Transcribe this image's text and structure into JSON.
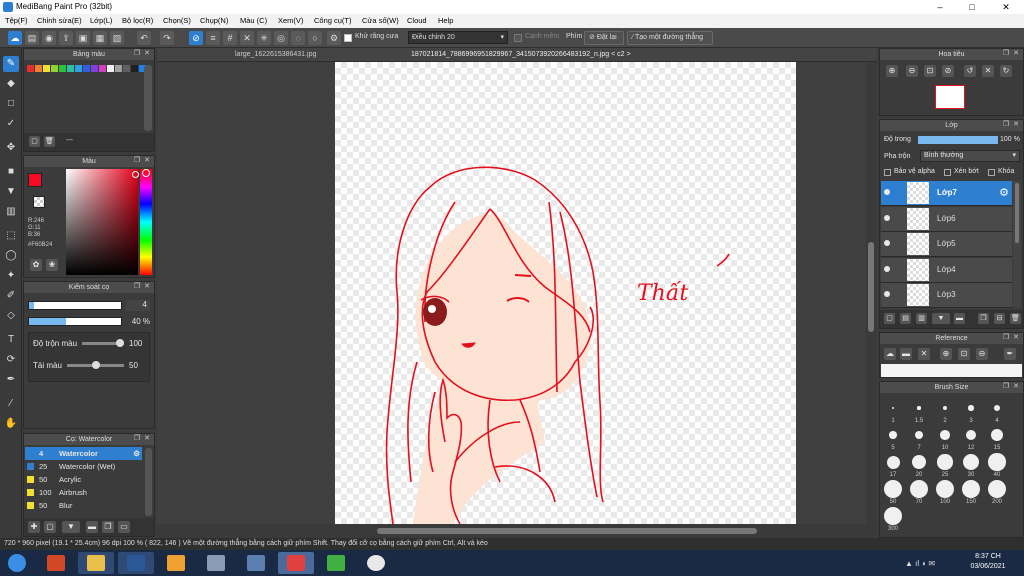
{
  "window": {
    "title": "MediBang Paint Pro (32bit)",
    "min": "–",
    "max": "□",
    "close": "✕"
  },
  "menu": [
    "Tệp(F)",
    "Chỉnh sửa(E)",
    "Lớp(L)",
    "Bộ lọc(R)",
    "Chọn(S)",
    "Chụp(N)",
    "Màu (C)",
    "Xem(V)",
    "Công cụ(T)",
    "Cửa sổ(W)",
    "Cloud",
    "Help"
  ],
  "toolbar": {
    "antialias_label": "Khử răng cưa",
    "correction_label": "Điều chỉnh",
    "correction_value": "20",
    "edge_label": "Cạnh mềm",
    "key_label": "Phím",
    "reset_label": "Đặt lại",
    "new_line_label": "Tạo một đường thẳng"
  },
  "colors": {
    "accent": "#2f7fd0",
    "stroke": "#e3101e",
    "skin": "#fde3d3"
  },
  "color_swatches_panel": {
    "title": "Bảng màu",
    "swatches": [
      "#e03030",
      "#f08030",
      "#f0e030",
      "#90d030",
      "#30c040",
      "#30c0a0",
      "#30a0e0",
      "#3060e0",
      "#8040e0",
      "#d040c0",
      "#f0f0f0",
      "#a0a0a0",
      "#606060",
      "#202020",
      "#2080f0"
    ],
    "footer": "---"
  },
  "color_panel": {
    "title": "Màu",
    "r": "R:246",
    "g": "G:11",
    "b": "B:36",
    "hex": "#F60B24",
    "primary": "#f60b24"
  },
  "brush_control": {
    "title": "Kiểm soát cọ",
    "size_value": "4",
    "opacity_value": "40 %",
    "mix_label": "Độ trộn màu",
    "mix_value": "100",
    "reload_label": "Tải màu",
    "reload_value": "50",
    "opacity_fraction": 0.4,
    "size_fraction": 0.05,
    "mix_fraction": 1.0,
    "reload_fraction": 0.5
  },
  "brush_list": {
    "title": "Cọ: Watercolor",
    "items": [
      {
        "size": "4",
        "name": "Watercolor",
        "color": "#2f7fd0"
      },
      {
        "size": "25",
        "name": "Watercolor (Wet)",
        "color": "#2f7fd0"
      },
      {
        "size": "50",
        "name": "Acrylic",
        "color": "#f0e030"
      },
      {
        "size": "100",
        "name": "Airbrush",
        "color": "#f0e030"
      },
      {
        "size": "50",
        "name": "Blur",
        "color": "#f0e030"
      }
    ]
  },
  "tabs": [
    {
      "label": "large_1622615386431.jpg"
    },
    {
      "label": "187021814_7886996951829967_3415073920266483192_n.jpg < c2 >"
    }
  ],
  "canvas_text": "Thất",
  "navigator": {
    "title": "Hoa tiêu"
  },
  "layer_panel": {
    "title": "Lớp",
    "opacity_label": "Độ trong",
    "opacity_value": "100 %",
    "opacity_fraction": 1.0,
    "blend_label": "Pha trộn",
    "blend_value": "Bình thường",
    "protect_alpha": "Bảo vệ alpha",
    "clipping": "Xén bớt",
    "lock": "Khóa",
    "layers": [
      "Lớp7",
      "Lớp6",
      "Lớp5",
      "Lớp4",
      "Lớp3"
    ]
  },
  "reference": {
    "title": "Reference"
  },
  "brush_size": {
    "title": "Brush Size",
    "labels": [
      "1",
      "1.5",
      "2",
      "3",
      "4",
      "5",
      "7",
      "10",
      "12",
      "15",
      "17",
      "20",
      "25",
      "30",
      "40",
      "50",
      "70",
      "100",
      "150",
      "200",
      "300"
    ]
  },
  "status": {
    "text": "720 * 960 pixel  (19.1 * 25.4cm)  96 dpi  100 %  ( 822, 146 )  Vẽ một đường thẳng bằng cách giữ phím Shift. Thay đổi cỡ cọ bằng cách giữ phím Ctrl, Alt và kéo"
  },
  "taskbar": {
    "time": "8:37 CH",
    "date": "03/06/2021"
  }
}
